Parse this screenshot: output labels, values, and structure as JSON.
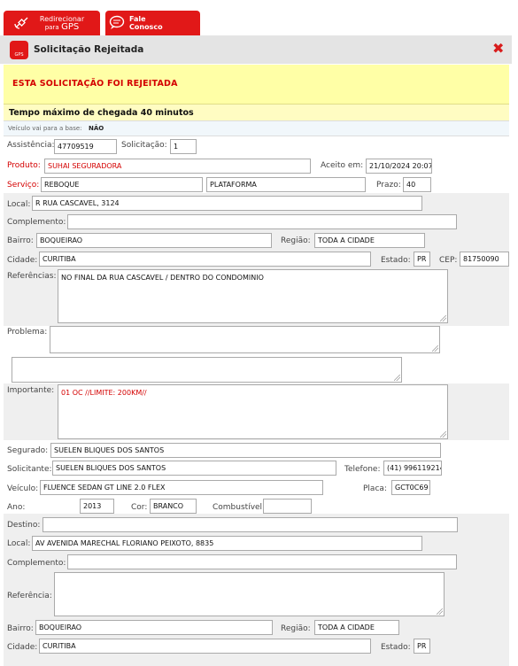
{
  "tabs": {
    "gps": {
      "line1": "Redirecionar",
      "line2": "para",
      "line3": "GPS"
    },
    "chat": {
      "line1": "Fale",
      "line2": "Conosco"
    }
  },
  "window": {
    "title": "Solicitação Rejeitada",
    "close": "✖"
  },
  "banner": {
    "rejected": "ESTA SOLICITAÇÃO FOI REJEITADA",
    "tempo": "Tempo máximo de chegada 40 minutos",
    "veiculo_base_label": "Veículo vai para a base:",
    "veiculo_base_value": "NÃO"
  },
  "labels": {
    "assistencia": "Assistência:",
    "solicitacao": "Solicitação:",
    "produto": "Produto:",
    "aceito_em": "Aceito em:",
    "servico": "Serviço:",
    "prazo": "Prazo:",
    "local": "Local:",
    "complemento": "Complemento:",
    "bairro": "Bairro:",
    "regiao": "Região:",
    "cidade": "Cidade:",
    "estado": "Estado:",
    "cep": "CEP:",
    "referencias": "Referências:",
    "problema": "Problema:",
    "importante": "Importante:",
    "segurado": "Segurado:",
    "solicitante": "Solicitante:",
    "telefone": "Telefone:",
    "veiculo": "Veículo:",
    "placa": "Placa:",
    "ano": "Ano:",
    "cor": "Cor:",
    "combustivel": "Combustível:",
    "destino": "Destino:",
    "referencia": "Referência:"
  },
  "values": {
    "assistencia": "47709519",
    "solicitacao": "1",
    "produto": "SUHAI SEGURADORA",
    "aceito_em": "21/10/2024 20:07",
    "servico": "REBOQUE",
    "servico2": "PLATAFORMA",
    "prazo": "40",
    "local": "R RUA CASCAVEL, 3124",
    "complemento": "",
    "bairro": "BOQUEIRAO",
    "regiao": "TODA A CIDADE",
    "cidade": "CURITIBA",
    "estado": "PR",
    "cep": "81750090",
    "referencias": "NO FINAL DA RUA CASCAVEL /  DENTRO DO CONDOMINIO",
    "problema": "",
    "importante": "01 OC  //LIMITE: 200KM//",
    "segurado": "SUELEN BLIQUES DOS SANTOS",
    "solicitante": "SUELEN BLIQUES DOS SANTOS",
    "telefone": "(41) 996119214",
    "veiculo": "FLUENCE SEDAN GT LINE 2.0 FLEX",
    "placa": "GCT0C69",
    "ano": "2013",
    "cor": "BRANCO",
    "combustivel": ""
  },
  "destino": {
    "destino": "",
    "local": "AV AVENIDA MARECHAL FLORIANO PEIXOTO, 8835",
    "complemento": "",
    "referencia": "",
    "bairro": "BOQUEIRAO",
    "regiao": "TODA A CIDADE",
    "cidade": "CURITIBA",
    "estado": "PR"
  }
}
